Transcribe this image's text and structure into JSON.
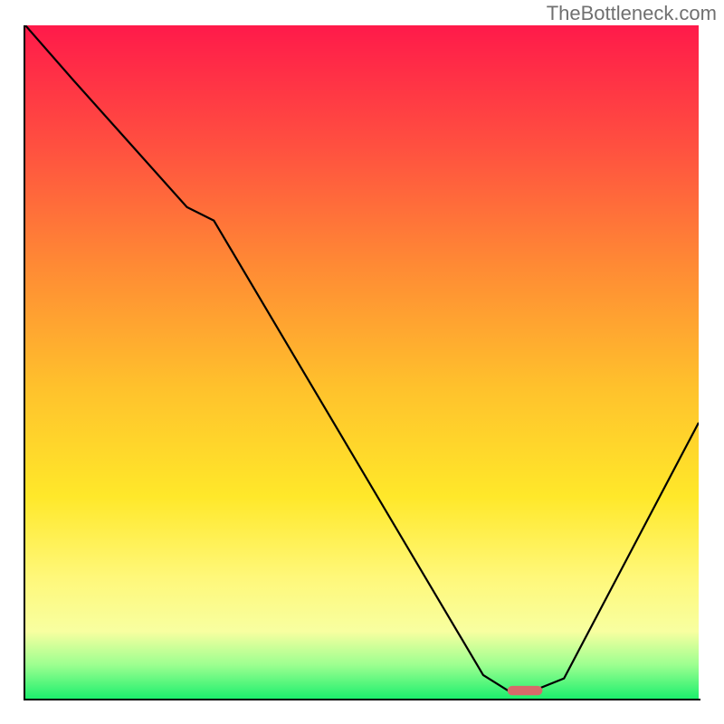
{
  "watermark": "TheBottleneck.com",
  "chart_data": {
    "type": "line",
    "title": "",
    "xlabel": "",
    "ylabel": "",
    "xlim": [
      0,
      100
    ],
    "ylim": [
      0,
      100
    ],
    "grid": false,
    "annotations": [],
    "legend": [],
    "series": [
      {
        "name": "bottleneck-curve",
        "x": [
          0,
          7,
          24,
          28,
          68,
          72,
          75,
          80,
          100
        ],
        "values": [
          100,
          92,
          73,
          71,
          3.5,
          1,
          1,
          3,
          41
        ]
      }
    ],
    "marker": {
      "name": "optimal-point",
      "x": 74.2,
      "y": 1.2,
      "width_pct": 5.2,
      "height_pct": 1.4,
      "color": "#d86a6a"
    },
    "background": "vertical-gradient red-to-green"
  }
}
